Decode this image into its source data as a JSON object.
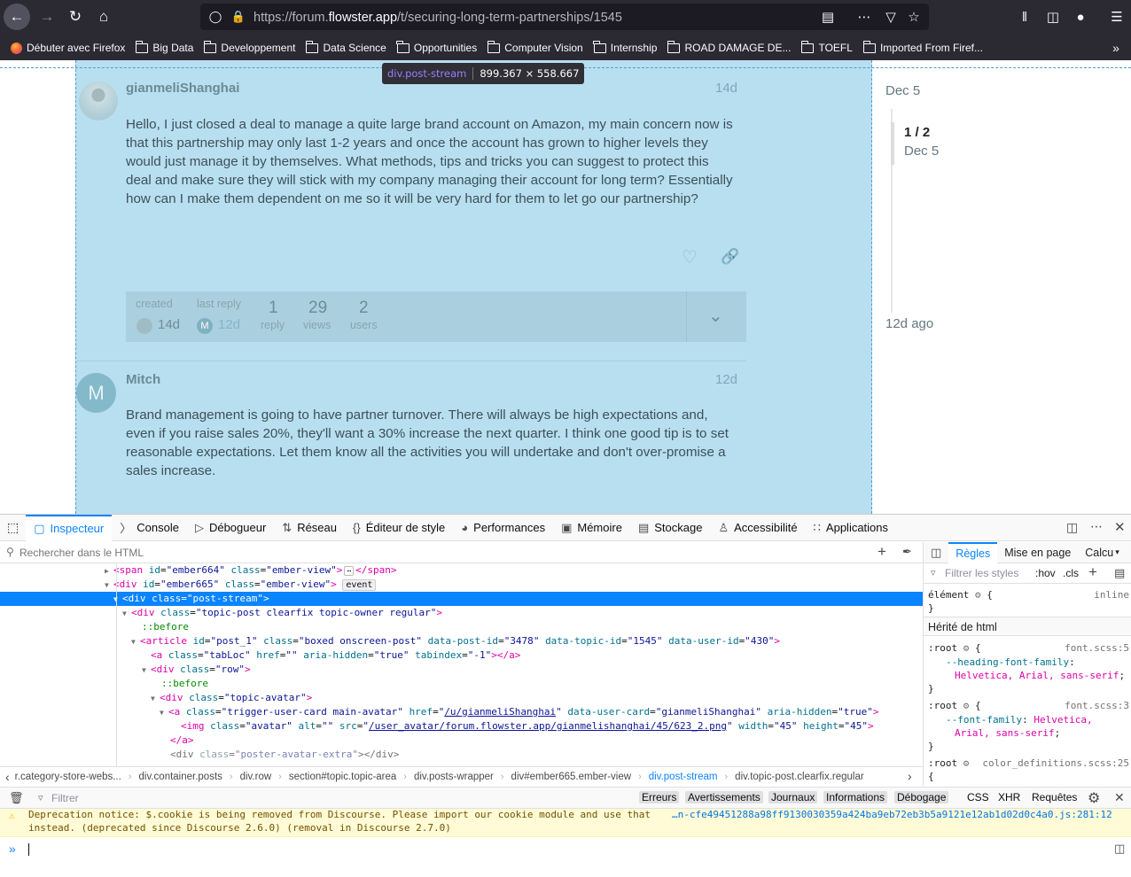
{
  "browser": {
    "url_prefix": "https://forum.",
    "url_domain": "flowster.app",
    "url_path": "/t/securing-long-term-partnerships/1545",
    "bookmarks": [
      "Débuter avec Firefox",
      "Big Data",
      "Developpement",
      "Data Science",
      "Opportunities",
      "Computer Vision",
      "Internship",
      "ROAD DAMAGE DE...",
      "TOEFL",
      "Imported From Firef..."
    ]
  },
  "highlight": {
    "selector": "div.post-stream",
    "size": "899.367 × 558.667"
  },
  "posts": [
    {
      "author": "gianmeliShanghai",
      "date": "14d",
      "body": "Hello, I just closed a deal to manage a quite large brand account on Amazon, my main concern now is that this partnership may only last 1-2 years and once the account has grown to higher levels they would just manage it by themselves. What methods, tips and tricks you can suggest to protect this deal and make sure they will stick with my company managing their account for long term? Essentially how can I make them dependent on me so it will be very hard for them to let go our partnership?",
      "meta": {
        "created_label": "created",
        "created_value": "14d",
        "last_reply_label": "last reply",
        "last_reply_value": "12d",
        "last_reply_avatar": "M",
        "replies": "1",
        "replies_label": "reply",
        "views": "29",
        "views_label": "views",
        "users": "2",
        "users_label": "users"
      }
    },
    {
      "author": "Mitch",
      "avatar_letter": "M",
      "date": "12d",
      "body": "Brand management is going to have partner turnover. There will always be high expectations and, even if you raise sales 20%, they'll want a 30% increase the next quarter. I think one good tip is to set reasonable expectations. Let them know all the activities you will undertake and don't over-promise a sales increase."
    }
  ],
  "timeline": {
    "top_date": "Dec 5",
    "position": "1 / 2",
    "position_date": "Dec 5",
    "bottom": "12d ago"
  },
  "devtools": {
    "tabs": [
      "Inspecteur",
      "Console",
      "Débogueur",
      "Réseau",
      "Éditeur de style",
      "Performances",
      "Mémoire",
      "Stockage",
      "Accessibilité",
      "Applications"
    ],
    "search_placeholder": "Rechercher dans le HTML",
    "markup": [
      {
        "tag": "span",
        "id": "ember664",
        "cls": "ember-view",
        "tail": "</span>"
      },
      {
        "tag": "div",
        "id": "ember665",
        "cls": "ember-view",
        "badge": "event"
      },
      {
        "tag": "div",
        "cls": "post-stream"
      },
      {
        "tag": "div",
        "cls": "topic-post clearfix topic-owner regular"
      },
      {
        "pseudo": "::before"
      },
      {
        "tag": "article",
        "id": "post_1",
        "cls": "boxed onscreen-post",
        "post_id": "3478",
        "topic_id": "1545",
        "user_id": "430"
      },
      {
        "tag": "a",
        "cls": "tabLoc",
        "href": "",
        "hidden": "true",
        "tabindex": "-1"
      },
      {
        "tag": "div",
        "cls": "row"
      },
      {
        "pseudo": "::before"
      },
      {
        "tag": "div",
        "cls": "topic-avatar"
      },
      {
        "tag": "a",
        "cls": "trigger-user-card main-avatar",
        "href": "/u/gianmeliShanghai",
        "card": "gianmeliShanghai",
        "hidden": "true"
      },
      {
        "tag": "img",
        "cls": "avatar",
        "alt": "",
        "src": "/user_avatar/forum.flowster.app/gianmelishanghai/45/623_2.png",
        "width": "45",
        "height": "45"
      },
      {
        "close": "</a>"
      },
      {
        "tag": "div",
        "cls": "poster-avatar-extra"
      }
    ],
    "breadcrumbs": [
      "r.category-store-webs...",
      "div.container.posts",
      "div.row",
      "section#topic.topic-area",
      "div.posts-wrapper",
      "div#ember665.ember-view",
      "div.post-stream",
      "div.topic-post.clearfix.regular"
    ],
    "rules_tabs": [
      "Règles",
      "Mise en page",
      "Calcu"
    ],
    "rules_filter": "Filtrer les styles",
    "rules_hov": ":hov",
    "rules_cls": ".cls",
    "element_label": "élément",
    "element_source": "inline",
    "inherited": "Hérité de html",
    "root_rules": [
      {
        "source": "font.scss:5",
        "prop": "--heading-font-family",
        "value": "Helvetica, Arial, sans-serif"
      },
      {
        "source": "font.scss:3",
        "prop": "--font-family",
        "value": "Helvetica, Arial"
      },
      {
        "source": "color_definitions.scss:25"
      }
    ],
    "console_filter": "Filtrer",
    "console_filters": [
      "Erreurs",
      "Avertissements",
      "Journaux",
      "Informations",
      "Débogage",
      "CSS",
      "XHR",
      "Requêtes"
    ],
    "warning_line1": "Deprecation notice: $.cookie is being removed from Discourse. Please import our cookie module and use that",
    "warning_line2": "instead. (deprecated since Discourse 2.6.0) (removal in Discourse 2.7.0)",
    "warning_source": "…n-cfe49451288a98ff9130030359a424ba9eb72eb3b5a9121e12ab1d02d0c4a0.js:281:12"
  }
}
